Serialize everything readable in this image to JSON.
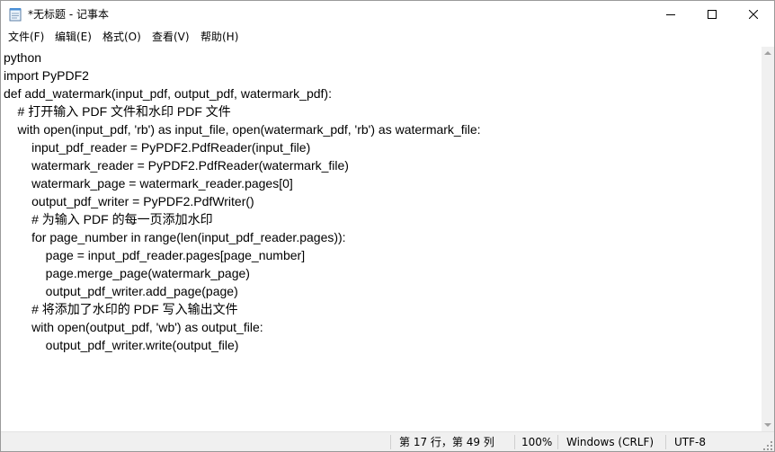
{
  "window": {
    "title": "*无标题 - 记事本"
  },
  "menu": {
    "items": [
      "文件(F)",
      "编辑(E)",
      "格式(O)",
      "查看(V)",
      "帮助(H)"
    ]
  },
  "editor": {
    "lines": [
      "python",
      "import PyPDF2",
      "def add_watermark(input_pdf, output_pdf, watermark_pdf):",
      "    # 打开输入 PDF 文件和水印 PDF 文件",
      "    with open(input_pdf, 'rb') as input_file, open(watermark_pdf, 'rb') as watermark_file:",
      "        input_pdf_reader = PyPDF2.PdfReader(input_file)",
      "        watermark_reader = PyPDF2.PdfReader(watermark_file)",
      "        watermark_page = watermark_reader.pages[0]",
      "        output_pdf_writer = PyPDF2.PdfWriter()",
      "        # 为输入 PDF 的每一页添加水印",
      "        for page_number in range(len(input_pdf_reader.pages)):",
      "            page = input_pdf_reader.pages[page_number]",
      "            page.merge_page(watermark_page)",
      "            output_pdf_writer.add_page(page)",
      "        # 将添加了水印的 PDF 写入输出文件",
      "        with open(output_pdf, 'wb') as output_file:",
      "            output_pdf_writer.write(output_file)"
    ]
  },
  "status": {
    "position": "第 17 行，第 49 列",
    "zoom": "100%",
    "line_ending": "Windows (CRLF)",
    "encoding": "UTF-8"
  },
  "icons": {
    "app": "notepad-icon",
    "minimize": "minimize-icon",
    "maximize": "maximize-icon",
    "close": "close-icon"
  }
}
